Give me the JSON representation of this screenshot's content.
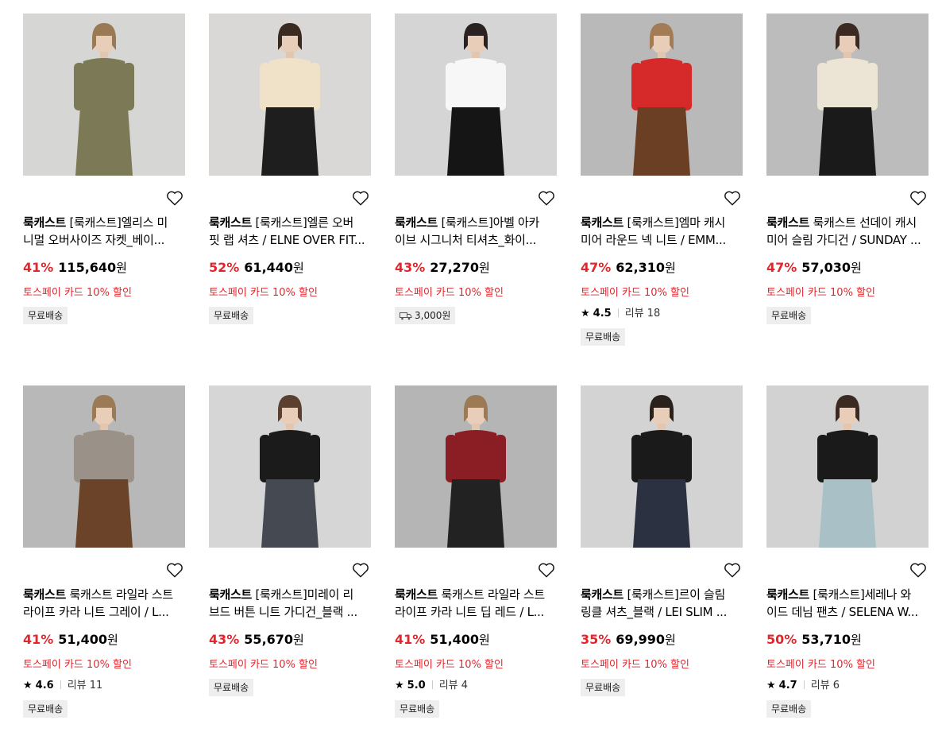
{
  "products": [
    {
      "brand": "룩캐스트",
      "title_line1": "[룩캐스트]엘리스 미",
      "title_line2": "니멀 오버사이즈 자켓_베이...",
      "discount": "41%",
      "price": "115,640",
      "currency": "원",
      "promo": "토스페이 카드 10% 할인",
      "rating": "",
      "review": "",
      "badge": "무료배송",
      "badge_icon": "",
      "image_desc": "olive-jacket"
    },
    {
      "brand": "룩캐스트",
      "title_line1": "[룩캐스트]엘른 오버",
      "title_line2": "핏 랩 셔츠 / ELNE OVER FIT...",
      "discount": "52%",
      "price": "61,440",
      "currency": "원",
      "promo": "토스페이 카드 10% 할인",
      "rating": "",
      "review": "",
      "badge": "무료배송",
      "badge_icon": "",
      "image_desc": "cream-shirt"
    },
    {
      "brand": "룩캐스트",
      "title_line1": "[룩캐스트]아벨 아카",
      "title_line2": "이브 시그니처 티셔츠_화이...",
      "discount": "43%",
      "price": "27,270",
      "currency": "원",
      "promo": "토스페이 카드 10% 할인",
      "rating": "",
      "review": "",
      "badge": "3,000원",
      "badge_icon": "truck-icon",
      "image_desc": "white-tshirt"
    },
    {
      "brand": "룩캐스트",
      "title_line1": "[룩캐스트]엠마 캐시",
      "title_line2": "미어 라운드 넥 니트 / EMM...",
      "discount": "47%",
      "price": "62,310",
      "currency": "원",
      "promo": "토스페이 카드 10% 할인",
      "rating": "4.5",
      "review": "리뷰 18",
      "badge": "무료배송",
      "badge_icon": "",
      "image_desc": "red-knit"
    },
    {
      "brand": "룩캐스트",
      "title_line1": "룩캐스트 선데이 캐시",
      "title_line2": "미어 슬림 가디건 / SUNDAY ...",
      "discount": "47%",
      "price": "57,030",
      "currency": "원",
      "promo": "토스페이 카드 10% 할인",
      "rating": "",
      "review": "",
      "badge": "무료배송",
      "badge_icon": "",
      "image_desc": "ivory-cardigan"
    },
    {
      "brand": "룩캐스트",
      "title_line1": "룩캐스트 라일라 스트",
      "title_line2": "라이프 카라 니트 그레이 / L...",
      "discount": "41%",
      "price": "51,400",
      "currency": "원",
      "promo": "토스페이 카드 10% 할인",
      "rating": "4.6",
      "review": "리뷰 11",
      "badge": "무료배송",
      "badge_icon": "",
      "image_desc": "grey-stripe-knit"
    },
    {
      "brand": "룩캐스트",
      "title_line1": "[룩캐스트]미레이 리",
      "title_line2": "브드 버튼 니트 가디건_블랙 ...",
      "discount": "43%",
      "price": "55,670",
      "currency": "원",
      "promo": "토스페이 카드 10% 할인",
      "rating": "",
      "review": "",
      "badge": "무료배송",
      "badge_icon": "",
      "image_desc": "black-cardigan"
    },
    {
      "brand": "룩캐스트",
      "title_line1": "룩캐스트 라일라 스트",
      "title_line2": "라이프 카라 니트 딥 레드 / L...",
      "discount": "41%",
      "price": "51,400",
      "currency": "원",
      "promo": "토스페이 카드 10% 할인",
      "rating": "5.0",
      "review": "리뷰 4",
      "badge": "무료배송",
      "badge_icon": "",
      "image_desc": "red-stripe-knit"
    },
    {
      "brand": "룩캐스트",
      "title_line1": "[룩캐스트]르이 슬림",
      "title_line2": "링클 셔츠_블랙 / LEI SLIM ...",
      "discount": "35%",
      "price": "69,990",
      "currency": "원",
      "promo": "토스페이 카드 10% 할인",
      "rating": "",
      "review": "",
      "badge": "무료배송",
      "badge_icon": "",
      "image_desc": "black-shirt"
    },
    {
      "brand": "룩캐스트",
      "title_line1": "[룩캐스트]세레나 와",
      "title_line2": "이드 데님 팬츠 / SELENA W...",
      "discount": "50%",
      "price": "53,710",
      "currency": "원",
      "promo": "토스페이 카드 10% 할인",
      "rating": "4.7",
      "review": "리뷰 6",
      "badge": "무료배송",
      "badge_icon": "",
      "image_desc": "wide-denim"
    }
  ],
  "colors": {
    "accent": "#e4262c",
    "badge_bg": "#eeeeee"
  }
}
